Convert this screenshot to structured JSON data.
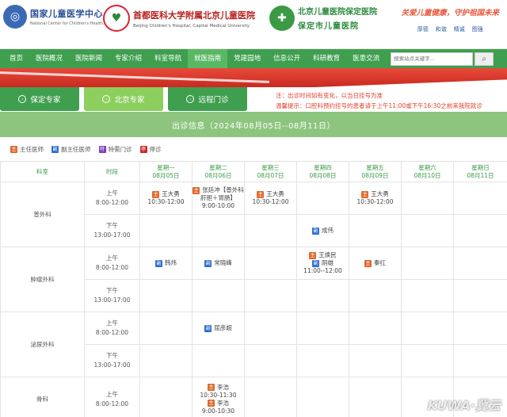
{
  "header": {
    "logo1": {
      "title": "国家儿童医学中心",
      "sub": "National Center for Children's Health, China"
    },
    "logo2": {
      "title": "首都医科大学附属北京儿童医院",
      "sub": "Beijing Children's Hospital, Capital Medical University"
    },
    "logo3": {
      "title": "北京儿童医院保定医院",
      "sub": "保定市儿童医院"
    },
    "slogan": "关爱儿童健康，守护祖国未来",
    "links": [
      "厚德",
      "和谐",
      "精诚",
      "图强"
    ]
  },
  "nav": {
    "items": [
      "首页",
      "医院概况",
      "医院新闻",
      "专家介绍",
      "科室导航",
      "就医指南",
      "党建园地",
      "信息公开",
      "科研教育",
      "医患交流"
    ],
    "search_placeholder": "搜索站点关键字..."
  },
  "tabs": [
    "保定专家",
    "北京专家",
    "远程门诊"
  ],
  "notice": {
    "line1": "注：出诊时间如有变化，以当日挂号为准",
    "line2": "温馨提示：口腔科预约挂号的患者请于上午11:00或下午16:30之前来我院就诊"
  },
  "schedule_title": "出诊信息（2024年08月05日--08月11日）",
  "legend": [
    {
      "mark": "主",
      "label": "主任医师",
      "color": "#e06a2b"
    },
    {
      "mark": "副",
      "label": "副主任医师",
      "color": "#2e6fd0"
    },
    {
      "mark": "特",
      "label": "特需门诊",
      "color": "#7a3dc0"
    },
    {
      "mark": "停",
      "label": "停诊",
      "color": "#d02828"
    }
  ],
  "table": {
    "col_dept": "科室",
    "col_time": "时段",
    "days": [
      {
        "name": "星期一",
        "date": "08月05日"
      },
      {
        "name": "星期二",
        "date": "08月06日"
      },
      {
        "name": "星期三",
        "date": "08月07日"
      },
      {
        "name": "星期四",
        "date": "08月08日"
      },
      {
        "name": "星期五",
        "date": "08月09日"
      },
      {
        "name": "星期六",
        "date": "08月10日"
      },
      {
        "name": "星期日",
        "date": "08月11日"
      }
    ],
    "am": "上午",
    "am_time": "8:00-12:00",
    "pm": "下午",
    "pm_time": "13:00-17:00",
    "depts": [
      {
        "name": "普外科"
      },
      {
        "name": "肿瘤外科"
      },
      {
        "name": "泌尿外科"
      },
      {
        "name": "骨科"
      }
    ],
    "cells": {
      "d0_am_mon": {
        "name": "王大勇",
        "time": "10:30-12:00"
      },
      "d0_am_tue": {
        "name": "张廷冲【普外科 肝胆＋胃肠】",
        "time": "9:00-10:00"
      },
      "d0_am_wed": {
        "name": "王大勇",
        "time": "10:30-12:00"
      },
      "d0_am_fri": {
        "name": "王大勇",
        "time": "10:30-12:00"
      },
      "d0_pm_thu": {
        "name": "成伟"
      },
      "d1_am_mon": {
        "name": "韩炜"
      },
      "d1_am_tue": {
        "name": "常晓峰"
      },
      "d1_am_thu_1": {
        "name": "王焕民"
      },
      "d1_am_thu_2": {
        "name": "阴雄",
        "time": "11:00--12:00"
      },
      "d1_am_fri": {
        "name": "秦红"
      },
      "d2_am_tue": {
        "name": "屈彦超"
      },
      "d3_am_tue_1": {
        "name": "李浩",
        "time": "10:30-11:30"
      },
      "d3_am_tue_2": {
        "name": "李浩",
        "time": "9:00-10:30"
      }
    }
  },
  "watermark": "KUWA·冀云"
}
